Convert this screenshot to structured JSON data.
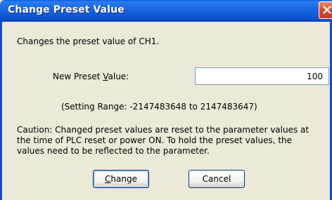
{
  "window": {
    "title": "Change Preset Value",
    "close_icon": "close-icon",
    "colors": {
      "titlebar": "#0b52cf",
      "body": "#ece9d8",
      "close": "#d54b2a"
    }
  },
  "description": "Changes the preset value of CH1.",
  "preset": {
    "label_before": "New Preset ",
    "label_accel": "V",
    "label_after": "alue:",
    "value": "100"
  },
  "setting_range": "(Setting Range: -2147483648 to 2147483647)",
  "caution_lines": [
    "Caution: Changed preset values are reset to the parameter values at",
    "the time of PLC reset or power ON. To hold the preset values, the",
    "values need to be reflected to the parameter."
  ],
  "buttons": {
    "change_accel": "C",
    "change_rest": "hange",
    "cancel": "Cancel"
  }
}
